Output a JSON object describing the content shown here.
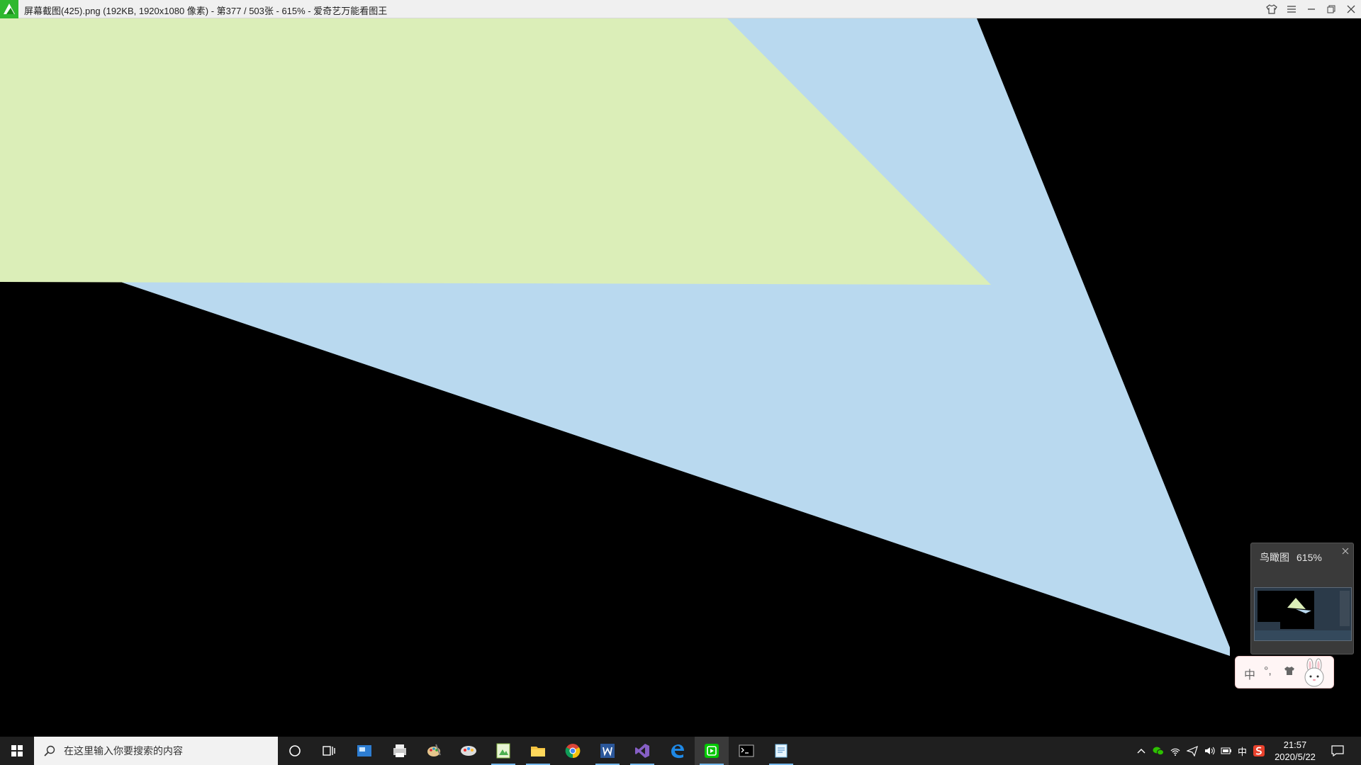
{
  "window": {
    "title": "屏幕截图(425).png (192KB, 1920x1080 像素) - 第377 / 503张 - 615% - 爱奇艺万能看图王"
  },
  "colors": {
    "green_region": "#dbeeb8",
    "blue_region": "#b9d9ef",
    "background": "#000000",
    "app_green": "#2eb82e",
    "taskbar": "#1f1f1f"
  },
  "navigator": {
    "label": "鸟瞰图",
    "zoom": "615%"
  },
  "ime": {
    "lang": "中",
    "punct": "°,",
    "skin_icon": "shirt-icon",
    "mascot_icon": "rabbit-icon"
  },
  "taskbar": {
    "search_placeholder": "在这里输入你要搜索的内容",
    "apps": [
      "cortana-icon",
      "task-view-icon",
      "app-blue-icon",
      "app-printer-icon",
      "paint-icon",
      "app-palette-icon",
      "image-viewer-icon",
      "file-explorer-icon",
      "chrome-icon",
      "word-icon",
      "visual-studio-icon",
      "edge-icon",
      "iqiyi-viewer-icon",
      "terminal-icon",
      "notepad-icon"
    ],
    "tray": {
      "ime_lang": "中",
      "time": "21:57",
      "date": "2020/5/22"
    }
  }
}
